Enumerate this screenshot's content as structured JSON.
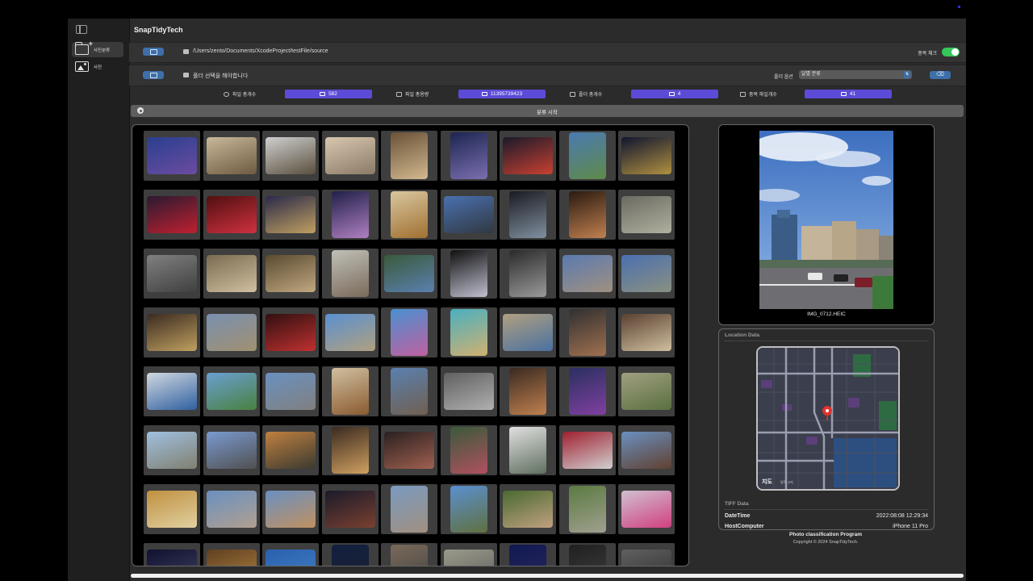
{
  "app": {
    "title": "SnapTidyTech"
  },
  "sidebar": {
    "items": [
      {
        "label": "사진분류",
        "icon": "folder-add-icon"
      },
      {
        "label": "사진",
        "icon": "photo-icon"
      }
    ]
  },
  "source": {
    "path": "/Users/zento/Documents/XcodeProject/testFile/source"
  },
  "duplicate_check": {
    "label": "중복 체크",
    "enabled": true
  },
  "destination": {
    "placeholder": "폴더 선택을 해야합니다"
  },
  "folder_option": {
    "label": "폴더 옵션",
    "selected": "달별 분류"
  },
  "stats": {
    "total_files": {
      "label": "파일 총개수",
      "value": "582"
    },
    "total_size": {
      "label": "파일 총용량",
      "value": "11395739423"
    },
    "total_folders": {
      "label": "폴더 총개수",
      "value": "4"
    },
    "duplicate_files": {
      "label": "중복 파일개수",
      "value": "41"
    }
  },
  "start_button": {
    "label": "분류 시작"
  },
  "preview": {
    "filename": "IMG_0712.HEIC"
  },
  "location": {
    "title": "Location Data",
    "map_brand": "지도",
    "map_legal": "법적 고지"
  },
  "tiff": {
    "title": "TIFF Data",
    "rows": [
      {
        "key": "DateTime",
        "value": "2022:08:08 12:29:34"
      },
      {
        "key": "HostComputer",
        "value": "iPhone 11 Pro"
      }
    ]
  },
  "footer": {
    "title": "Photo classification Program",
    "copyright": "Copyright © 2024 SnapTidyTech."
  },
  "colors": {
    "accent": "#5b4bd6",
    "button": "#3d6fa8",
    "toggle_on": "#34c759"
  },
  "thumbnails": [
    [
      "#2a3f8f",
      "#6b4ca0"
    ],
    [
      "#c9b89a",
      "#6d5a40"
    ],
    [
      "#cfcfcf",
      "#5a4f3d"
    ],
    [
      "#d9c7b0",
      "#8a7a66"
    ],
    [
      "#6a5138",
      "#d2b98f"
    ],
    [
      "#1c2550",
      "#7a6fb0"
    ],
    [
      "#1a1a2a",
      "#c84030"
    ],
    [
      "#4a7ab0",
      "#5f8a4a"
    ],
    [
      "#101530",
      "#b09040"
    ],
    [
      "#2a1a30",
      "#c02030"
    ],
    [
      "#501010",
      "#d03040"
    ],
    [
      "#2a2a4a",
      "#c0a060"
    ],
    [
      "#20204a",
      "#b080c0"
    ],
    [
      "#d9c7a0",
      "#a07030"
    ],
    [
      "#4a70b0",
      "#303840"
    ],
    [
      "#1a1a20",
      "#8090a0"
    ],
    [
      "#2a1a10",
      "#c08050"
    ],
    [
      "#6a6a60",
      "#b0b0a0"
    ],
    [
      "#808080",
      "#404040"
    ],
    [
      "#7a6a50",
      "#d0c0a0"
    ],
    [
      "#5a4a30",
      "#c0a880"
    ],
    [
      "#c0c0b8",
      "#7a6a5a"
    ],
    [
      "#3a5a3a",
      "#5a80b0"
    ],
    [
      "#101010",
      "#c0c0d0"
    ],
    [
      "#2a2a2a",
      "#9a9a9a"
    ],
    [
      "#5a7ab0",
      "#a09080"
    ],
    [
      "#4a70b0",
      "#8a9080"
    ],
    [
      "#3a2a20",
      "#c0a060"
    ],
    [
      "#7a90b0",
      "#a09070"
    ],
    [
      "#301010",
      "#c03030"
    ],
    [
      "#5a90d0",
      "#b0a080"
    ],
    [
      "#4a90d0",
      "#c060a0"
    ],
    [
      "#4ab0c0",
      "#d0b070"
    ],
    [
      "#b0a080",
      "#4a70a0"
    ],
    [
      "#303030",
      "#a07050"
    ],
    [
      "#5a4030",
      "#d0c0a0"
    ],
    [
      "#d0d8e0",
      "#3060a0"
    ],
    [
      "#6aa0d0",
      "#4a8040"
    ],
    [
      "#6a90c0",
      "#808080"
    ],
    [
      "#d0c0a0",
      "#8a5a30"
    ],
    [
      "#5a80b0",
      "#706050"
    ],
    [
      "#606060",
      "#b0b0b0"
    ],
    [
      "#3a2a20",
      "#c08050"
    ],
    [
      "#2a3060",
      "#8040a0"
    ],
    [
      "#a0a080",
      "#5a7040"
    ],
    [
      "#a0c0e0",
      "#808070"
    ],
    [
      "#7a9ad0",
      "#505050"
    ],
    [
      "#c08040",
      "#3a3a30"
    ],
    [
      "#3a2a20",
      "#d0a060"
    ],
    [
      "#2a2020",
      "#a06050"
    ],
    [
      "#3a5a3a",
      "#b05060"
    ],
    [
      "#e0e0e0",
      "#607060"
    ],
    [
      "#a02030",
      "#d0d0d0"
    ],
    [
      "#6a90c0",
      "#604030"
    ],
    [
      "#c09040",
      "#e0d0a0"
    ],
    [
      "#6a90c0",
      "#b0a090"
    ],
    [
      "#6a90c0",
      "#c09060"
    ],
    [
      "#1a1a2a",
      "#7a4030"
    ],
    [
      "#7a9ac0",
      "#a09080"
    ],
    [
      "#5a90d0",
      "#607040"
    ],
    [
      "#4a6a30",
      "#c0a080"
    ],
    [
      "#5a7a40",
      "#a0a090"
    ],
    [
      "#d0c0d0",
      "#d04080"
    ],
    [
      "#101030",
      "#404060"
    ],
    [
      "#604020",
      "#b08040"
    ],
    [
      "#2a60b0",
      "#4080c0"
    ],
    [
      "#102040",
      "#202030"
    ],
    [
      "#7a6a5a",
      "#404040"
    ],
    [
      "#9a9a8a",
      "#606060"
    ],
    [
      "#101850",
      "#2a2a60"
    ],
    [
      "#202020",
      "#404040"
    ],
    [
      "#606060",
      "#303030"
    ]
  ]
}
